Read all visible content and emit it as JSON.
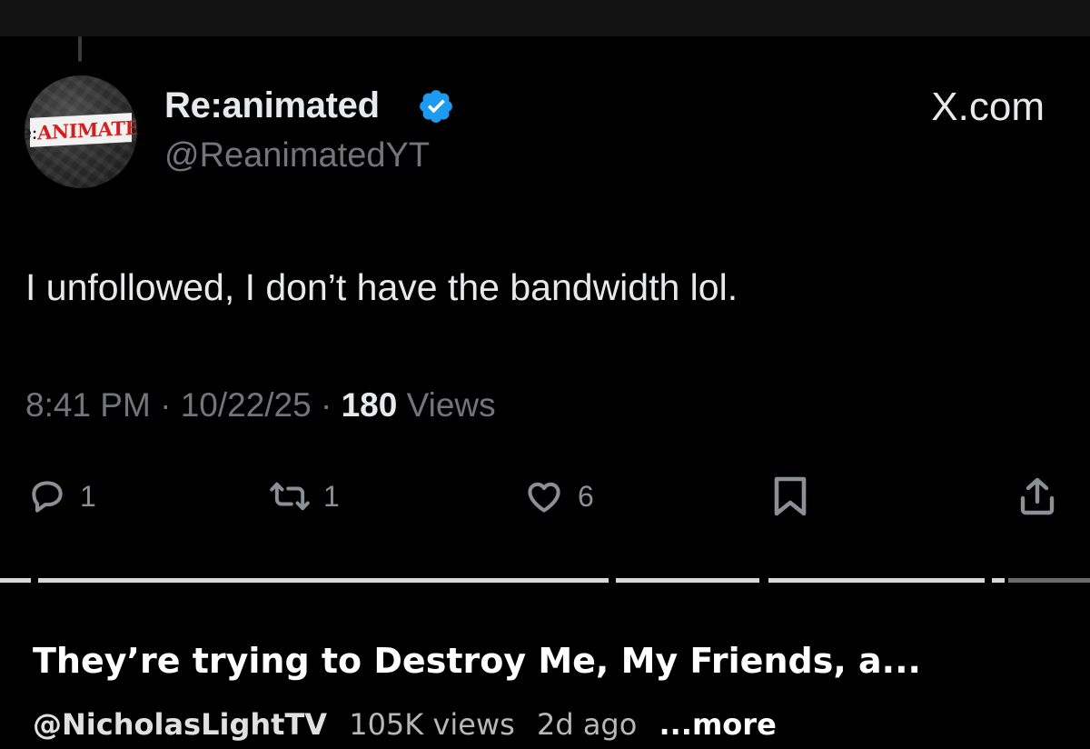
{
  "post": {
    "display_name": "Re:animated",
    "handle": "@ReanimatedYT",
    "verified_icon": "verified-badge-icon",
    "verified_color": "#1d9bf0",
    "brand_label": "X.com",
    "avatar_logo_prefix": "Re:",
    "avatar_logo_main": "ANIMATED",
    "text": "I unfollowed, I don’t have the bandwidth lol.",
    "time": "8:41 PM",
    "separator": "·",
    "date": "10/22/25",
    "views_count": "180",
    "views_label": "Views",
    "actions": {
      "reply_icon": "reply-icon",
      "reply_count": "1",
      "repost_icon": "repost-icon",
      "repost_count": "1",
      "like_icon": "heart-icon",
      "like_count": "6",
      "bookmark_icon": "bookmark-icon",
      "share_icon": "share-icon"
    }
  },
  "video": {
    "title": "They’re trying to Destroy Me, My Friends, a...",
    "channel": "@NicholasLightTV",
    "views": "105K views",
    "age": "2d ago",
    "more_label": "...more"
  }
}
